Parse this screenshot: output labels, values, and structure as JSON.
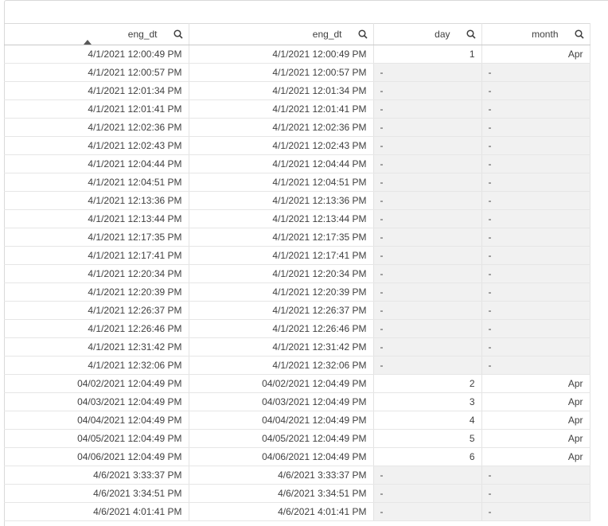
{
  "columns": [
    {
      "label": "eng_dt",
      "sorted": "ascending"
    },
    {
      "label": "eng_dt"
    },
    {
      "label": "day"
    },
    {
      "label": "month"
    }
  ],
  "null_marker": "-",
  "rows": [
    [
      "4/1/2021 12:00:49 PM",
      "4/1/2021 12:00:49 PM",
      "1",
      "Apr"
    ],
    [
      "4/1/2021 12:00:57 PM",
      "4/1/2021 12:00:57 PM",
      null,
      null
    ],
    [
      "4/1/2021 12:01:34 PM",
      "4/1/2021 12:01:34 PM",
      null,
      null
    ],
    [
      "4/1/2021 12:01:41 PM",
      "4/1/2021 12:01:41 PM",
      null,
      null
    ],
    [
      "4/1/2021 12:02:36 PM",
      "4/1/2021 12:02:36 PM",
      null,
      null
    ],
    [
      "4/1/2021 12:02:43 PM",
      "4/1/2021 12:02:43 PM",
      null,
      null
    ],
    [
      "4/1/2021 12:04:44 PM",
      "4/1/2021 12:04:44 PM",
      null,
      null
    ],
    [
      "4/1/2021 12:04:51 PM",
      "4/1/2021 12:04:51 PM",
      null,
      null
    ],
    [
      "4/1/2021 12:13:36 PM",
      "4/1/2021 12:13:36 PM",
      null,
      null
    ],
    [
      "4/1/2021 12:13:44 PM",
      "4/1/2021 12:13:44 PM",
      null,
      null
    ],
    [
      "4/1/2021 12:17:35 PM",
      "4/1/2021 12:17:35 PM",
      null,
      null
    ],
    [
      "4/1/2021 12:17:41 PM",
      "4/1/2021 12:17:41 PM",
      null,
      null
    ],
    [
      "4/1/2021 12:20:34 PM",
      "4/1/2021 12:20:34 PM",
      null,
      null
    ],
    [
      "4/1/2021 12:20:39 PM",
      "4/1/2021 12:20:39 PM",
      null,
      null
    ],
    [
      "4/1/2021 12:26:37 PM",
      "4/1/2021 12:26:37 PM",
      null,
      null
    ],
    [
      "4/1/2021 12:26:46 PM",
      "4/1/2021 12:26:46 PM",
      null,
      null
    ],
    [
      "4/1/2021 12:31:42 PM",
      "4/1/2021 12:31:42 PM",
      null,
      null
    ],
    [
      "4/1/2021 12:32:06 PM",
      "4/1/2021 12:32:06 PM",
      null,
      null
    ],
    [
      "04/02/2021 12:04:49 PM",
      "04/02/2021 12:04:49 PM",
      "2",
      "Apr"
    ],
    [
      "04/03/2021 12:04:49 PM",
      "04/03/2021 12:04:49 PM",
      "3",
      "Apr"
    ],
    [
      "04/04/2021 12:04:49 PM",
      "04/04/2021 12:04:49 PM",
      "4",
      "Apr"
    ],
    [
      "04/05/2021 12:04:49 PM",
      "04/05/2021 12:04:49 PM",
      "5",
      "Apr"
    ],
    [
      "04/06/2021 12:04:49 PM",
      "04/06/2021 12:04:49 PM",
      "6",
      "Apr"
    ],
    [
      "4/6/2021 3:33:37 PM",
      "4/6/2021 3:33:37 PM",
      null,
      null
    ],
    [
      "4/6/2021 3:34:51 PM",
      "4/6/2021 3:34:51 PM",
      null,
      null
    ],
    [
      "4/6/2021 4:01:41 PM",
      "4/6/2021 4:01:41 PM",
      null,
      null
    ]
  ]
}
